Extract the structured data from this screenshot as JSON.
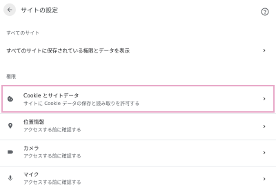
{
  "header": {
    "title": "サイトの設定",
    "back_icon": "arrow-left-icon",
    "help_icon": "help-circle-icon"
  },
  "all_sites": {
    "section_label": "すべてのサイト",
    "row_label": "すべてのサイトに保存されている権限とデータを表示"
  },
  "permissions": {
    "section_label": "権限",
    "items": [
      {
        "icon": "cookie-icon",
        "title": "Cookie とサイトデータ",
        "subtitle": "サイトに Cookie データの保存と読み取りを許可する"
      },
      {
        "icon": "location-pin-icon",
        "title": "位置情報",
        "subtitle": "アクセスする前に確認する"
      },
      {
        "icon": "camera-icon",
        "title": "カメラ",
        "subtitle": "アクセスする前に確認する"
      },
      {
        "icon": "microphone-icon",
        "title": "マイク",
        "subtitle": "アクセスする前に確認する"
      }
    ]
  },
  "colors": {
    "highlight_border": "#e8a8c8",
    "icon": "#5f6368",
    "divider": "#e8eaed"
  }
}
